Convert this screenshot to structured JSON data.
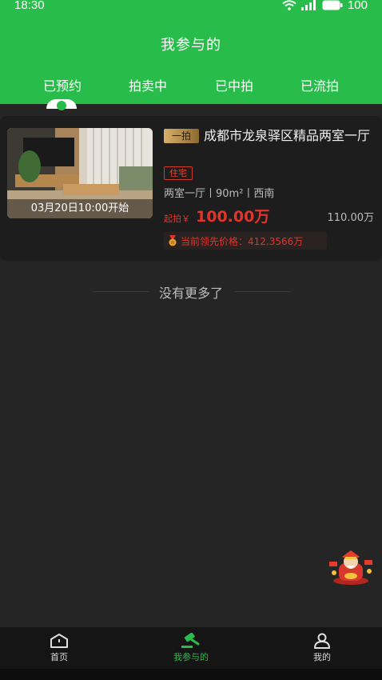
{
  "status_bar": {
    "time": "18:30",
    "battery": "100",
    "icons": [
      "wifi-icon",
      "signal-icon",
      "battery-icon"
    ]
  },
  "header": {
    "title": "我参与的",
    "tabs": [
      {
        "label": "已预约",
        "active": true
      },
      {
        "label": "拍卖中",
        "active": false
      },
      {
        "label": "已中拍",
        "active": false
      },
      {
        "label": "已流拍",
        "active": false
      }
    ]
  },
  "listing": {
    "badge": "一拍",
    "title": "成都市龙泉驿区精品两室一厅",
    "type_tag": "住宅",
    "specs": "两室一厅丨90m²丨西南",
    "start_time": "03月20日10:00开始",
    "start_price_label": "起拍￥",
    "start_price": "100.00万",
    "assessed_price": "110.00万",
    "leading_price_text": "当前领先价格：412.3566万"
  },
  "list_footer": {
    "no_more": "没有更多了"
  },
  "bottom_nav": {
    "items": [
      {
        "label": "首页",
        "icon": "home-icon",
        "active": false
      },
      {
        "label": "我参与的",
        "icon": "gavel-icon",
        "active": true
      },
      {
        "label": "我的",
        "icon": "user-icon",
        "active": false
      }
    ]
  },
  "colors": {
    "accent": "#28bd4a",
    "price": "#e2342a",
    "background": "#252525",
    "card": "#1d1d1d"
  }
}
